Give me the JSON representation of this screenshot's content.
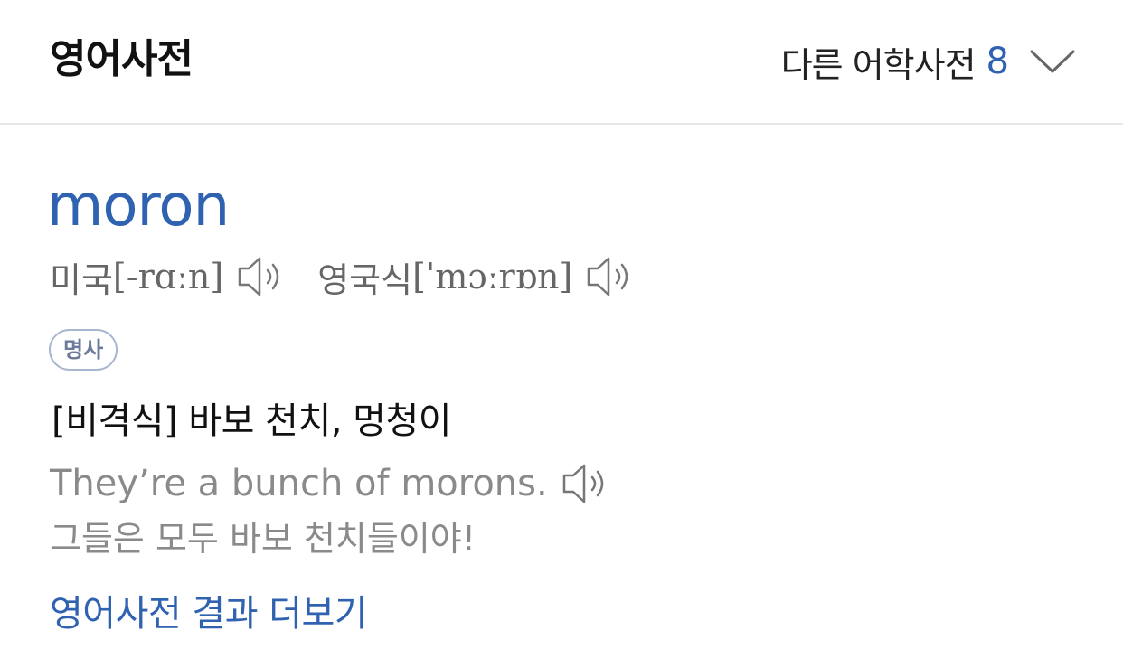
{
  "header": {
    "title": "영어사전",
    "other_dicts_label": "다른 어학사전",
    "other_dicts_count": "8"
  },
  "entry": {
    "word": "moron",
    "pronunciations": [
      {
        "label": "미국",
        "ipa": "[-rɑːn]"
      },
      {
        "label": "영국식",
        "ipa": "[ˈmɔːrɒn]"
      }
    ],
    "part_of_speech": "명사",
    "definition": "[비격식] 바보 천치, 멍청이",
    "example_en": "They’re a bunch of morons.",
    "example_ko": "그들은 모두 바보 천치들이야!"
  },
  "more_link": "영어사전 결과 더보기",
  "colors": {
    "accent": "#2f62b0",
    "muted_text": "#8a8a8a",
    "badge_border": "#a9b6cf"
  },
  "icons": {
    "speaker": "speaker-icon",
    "chevron": "chevron-down-icon"
  }
}
